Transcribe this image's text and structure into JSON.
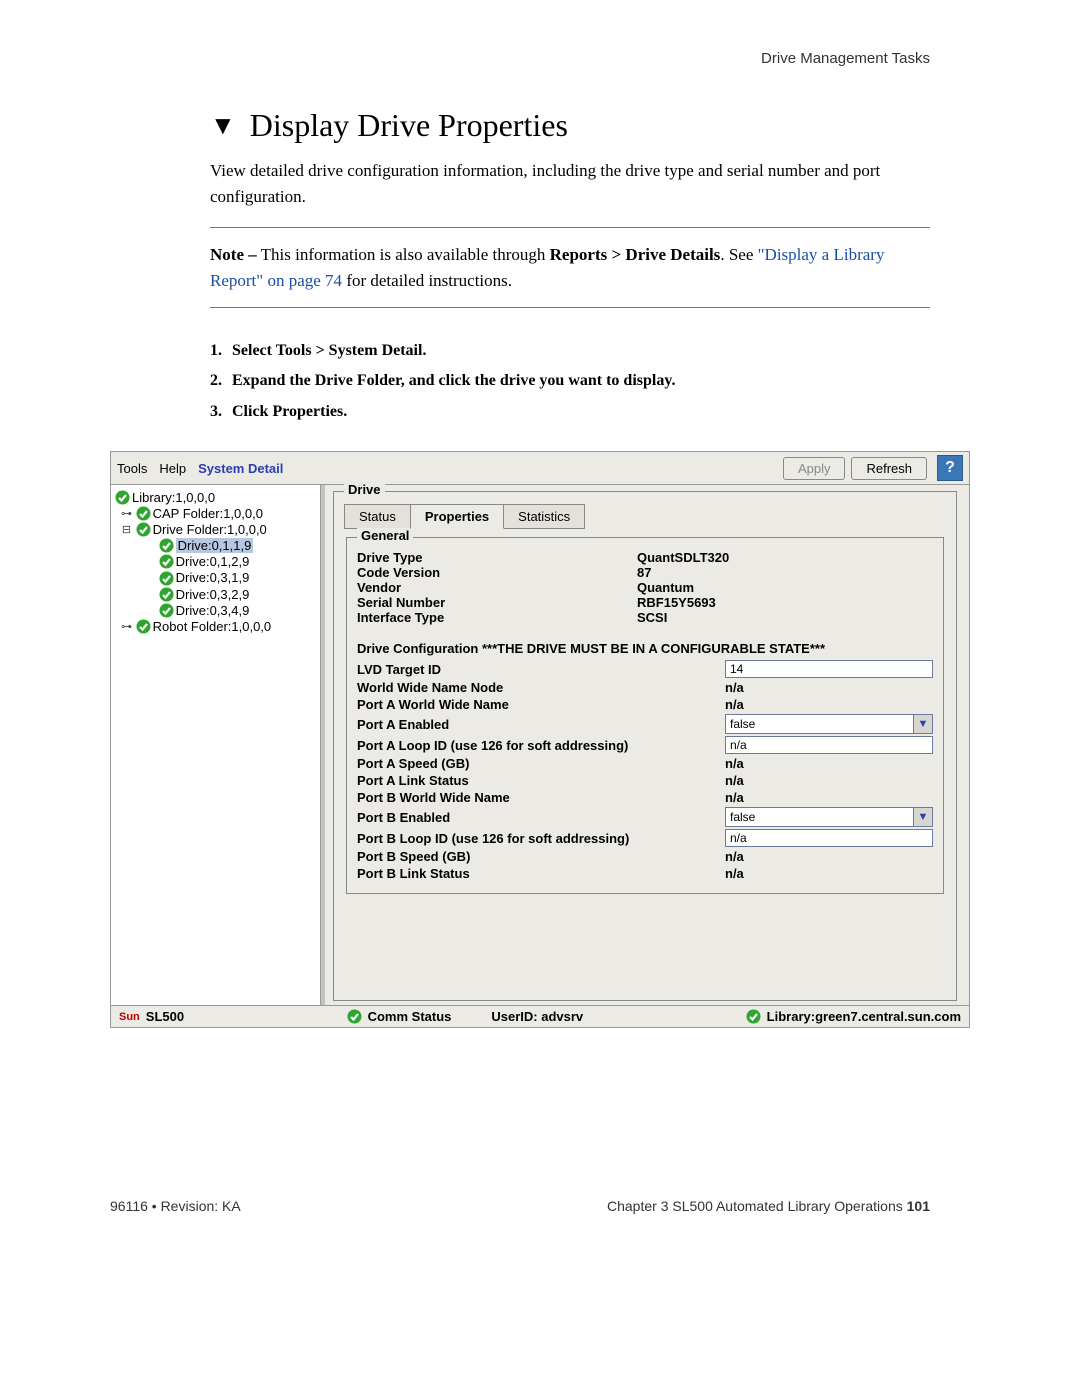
{
  "header": {
    "section": "Drive Management Tasks"
  },
  "title": "Display Drive Properties",
  "intro": "View detailed drive configuration information, including the drive type and serial number and port configuration.",
  "note": {
    "label": "Note –",
    "pre": " This information is also available through ",
    "bold_path": "Reports > Drive Details",
    "post_see": ". See ",
    "link": "\"Display a Library Report\" on page 74",
    "after_link": " for detailed instructions."
  },
  "steps": [
    "Select Tools > System Detail.",
    "Expand the Drive Folder, and click the drive you want to display.",
    "Click Properties."
  ],
  "menubar": {
    "tools": "Tools",
    "help": "Help",
    "system_detail": "System Detail",
    "apply": "Apply",
    "refresh": "Refresh",
    "help_icon": "?"
  },
  "tree": {
    "root": "Library:1,0,0,0",
    "cap": "CAP Folder:1,0,0,0",
    "drive_folder": "Drive Folder:1,0,0,0",
    "drives": [
      "Drive:0,1,1,9",
      "Drive:0,1,2,9",
      "Drive:0,3,1,9",
      "Drive:0,3,2,9",
      "Drive:0,3,4,9"
    ],
    "robot": "Robot Folder:1,0,0,0"
  },
  "panel": {
    "fieldset_label": "Drive",
    "tabs": {
      "status": "Status",
      "properties": "Properties",
      "statistics": "Statistics"
    },
    "general_label": "General",
    "general": {
      "drive_type_k": "Drive Type",
      "drive_type_v": "QuantSDLT320",
      "code_version_k": "Code Version",
      "code_version_v": "87",
      "vendor_k": "Vendor",
      "vendor_v": "Quantum",
      "serial_k": "Serial Number",
      "serial_v": "RBF15Y5693",
      "iface_k": "Interface Type",
      "iface_v": "SCSI"
    },
    "cfg_title": "Drive Configuration    ***THE DRIVE MUST BE IN A CONFIGURABLE STATE***",
    "cfg": {
      "lvd_k": "LVD Target ID",
      "lvd_v": "14",
      "wwn_node_k": "World Wide Name Node",
      "wwn_node_v": "n/a",
      "pa_wwn_k": "Port A World Wide Name",
      "pa_wwn_v": "n/a",
      "pa_en_k": "Port A Enabled",
      "pa_en_v": "false",
      "pa_loop_k": "Port A Loop ID (use 126 for soft addressing)",
      "pa_loop_v": "n/a",
      "pa_speed_k": "Port A Speed (GB)",
      "pa_speed_v": "n/a",
      "pa_link_k": "Port A Link Status",
      "pa_link_v": "n/a",
      "pb_wwn_k": "Port B World Wide Name",
      "pb_wwn_v": "n/a",
      "pb_en_k": "Port B Enabled",
      "pb_en_v": "false",
      "pb_loop_k": "Port B Loop ID (use 126 for soft addressing)",
      "pb_loop_v": "n/a",
      "pb_speed_k": "Port B Speed (GB)",
      "pb_speed_v": "n/a",
      "pb_link_k": "Port B Link Status",
      "pb_link_v": "n/a"
    }
  },
  "statusbar": {
    "brand_logo": "Sun",
    "brand_model": "SL500",
    "comm": "Comm Status",
    "userid": "UserID: advsrv",
    "library": "Library:green7.central.sun.com"
  },
  "footer": {
    "left": "96116  •  Revision: KA",
    "right_pre": "Chapter 3 SL500 Automated Library Operations   ",
    "page_no": "101"
  }
}
